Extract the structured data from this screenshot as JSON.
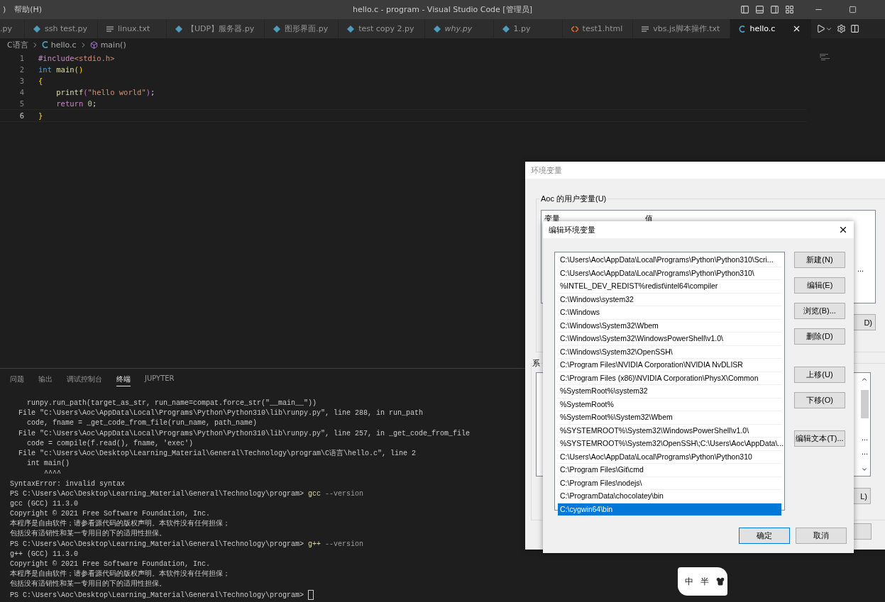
{
  "window": {
    "menu": [
      {
        "label": ")"
      },
      {
        "label": "帮助(H)"
      }
    ],
    "title": "hello.c - program - Visual Studio Code [管理员]"
  },
  "tabs": [
    {
      "label": ".py",
      "selected": false,
      "preview": false
    },
    {
      "label": "ssh test.py",
      "selected": false,
      "preview": false
    },
    {
      "label": "linux.txt",
      "selected": false,
      "preview": false
    },
    {
      "label": "【UDP】服务器.py",
      "selected": false,
      "preview": false
    },
    {
      "label": "图形界面.py",
      "selected": false,
      "preview": false
    },
    {
      "label": "test copy 2.py",
      "selected": false,
      "preview": false
    },
    {
      "label": "why.py",
      "selected": false,
      "preview": true
    },
    {
      "label": "1.py",
      "selected": false,
      "preview": false
    },
    {
      "label": "test1.html",
      "selected": false,
      "preview": false
    },
    {
      "label": "vbs.js脚本操作.txt",
      "selected": false,
      "preview": false
    },
    {
      "label": "hello.c",
      "selected": true,
      "preview": false
    }
  ],
  "breadcrumb": [
    {
      "label": "C语言"
    },
    {
      "label": "hello.c"
    },
    {
      "label": "main()"
    }
  ],
  "editor": {
    "lines": [
      {
        "number": "1",
        "active": false,
        "tokens": [
          {
            "text": "#include",
            "kind": "control"
          },
          {
            "text": "<stdio.h>",
            "kind": "string"
          }
        ]
      },
      {
        "number": "2",
        "active": false,
        "tokens": [
          {
            "text": "int",
            "kind": "type"
          },
          {
            "text": " main",
            "kind": "function"
          },
          {
            "text": "()",
            "kind": "bracket"
          }
        ]
      },
      {
        "number": "3",
        "active": false,
        "tokens": [
          {
            "text": "{",
            "kind": "bracket"
          }
        ]
      },
      {
        "number": "4",
        "active": false,
        "tokens": [
          {
            "text": "    printf",
            "kind": "function"
          },
          {
            "text": "(",
            "kind": "bracket2"
          },
          {
            "text": "\"hello world\"",
            "kind": "string"
          },
          {
            "text": ")",
            "kind": "bracket2"
          },
          {
            "text": ";",
            "kind": "plain"
          }
        ]
      },
      {
        "number": "5",
        "active": false,
        "tokens": [
          {
            "text": "    return",
            "kind": "control"
          },
          {
            "text": " 0",
            "kind": "number"
          },
          {
            "text": ";",
            "kind": "plain"
          }
        ]
      },
      {
        "number": "6",
        "active": true,
        "tokens": [
          {
            "text": "}",
            "kind": "bracket"
          }
        ]
      }
    ]
  },
  "panel": {
    "tabs": [
      {
        "label": "问题",
        "selected": false
      },
      {
        "label": "输出",
        "selected": false
      },
      {
        "label": "调试控制台",
        "selected": false
      },
      {
        "label": "终端",
        "selected": true
      },
      {
        "label": "JUPYTER",
        "selected": false
      }
    ],
    "terminal": [
      {
        "kind": "output",
        "text": "    runpy.run_path(target_as_str, run_name=compat.force_str(\"__main__\"))"
      },
      {
        "kind": "output",
        "text": "  File \"C:\\Users\\Aoc\\AppData\\Local\\Programs\\Python\\Python310\\lib\\runpy.py\", line 288, in run_path"
      },
      {
        "kind": "output",
        "text": "    code, fname = _get_code_from_file(run_name, path_name)"
      },
      {
        "kind": "output",
        "text": "  File \"C:\\Users\\Aoc\\AppData\\Local\\Programs\\Python\\Python310\\lib\\runpy.py\", line 257, in _get_code_from_file"
      },
      {
        "kind": "output",
        "text": "    code = compile(f.read(), fname, 'exec')"
      },
      {
        "kind": "output",
        "text": "  File \"c:\\Users\\Aoc\\Desktop\\Learning_Material\\General\\Technology\\program\\C语言\\hello.c\", line 2"
      },
      {
        "kind": "output",
        "text": "    int main()"
      },
      {
        "kind": "output",
        "text": "        ^^^^"
      },
      {
        "kind": "output",
        "text": "SyntaxError: invalid syntax"
      },
      {
        "kind": "prompt",
        "text": "PS C:\\Users\\Aoc\\Desktop\\Learning_Material\\General\\Technology\\program> ",
        "command": "gcc",
        "args": " --version"
      },
      {
        "kind": "output",
        "text": "gcc (GCC) 11.3.0"
      },
      {
        "kind": "output",
        "text": "Copyright © 2021 Free Software Foundation, Inc."
      },
      {
        "kind": "output",
        "text": "本程序是自由软件；请参看源代码的版权声明。本软件没有任何担保；"
      },
      {
        "kind": "output",
        "text": "包括没有适销性和某一专用目的下的适用性担保。"
      },
      {
        "kind": "prompt",
        "text": "PS C:\\Users\\Aoc\\Desktop\\Learning_Material\\General\\Technology\\program> ",
        "command": "g++",
        "args": " --version"
      },
      {
        "kind": "output",
        "text": "g++ (GCC) 11.3.0"
      },
      {
        "kind": "output",
        "text": "Copyright © 2021 Free Software Foundation, Inc."
      },
      {
        "kind": "output",
        "text": "本程序是自由软件；请参看源代码的版权声明。本软件没有任何担保；"
      },
      {
        "kind": "output",
        "text": "包括没有适销性和某一专用目的下的适用性担保。"
      },
      {
        "kind": "cursor",
        "text": "PS C:\\Users\\Aoc\\Desktop\\Learning_Material\\General\\Technology\\program> "
      }
    ]
  },
  "env_dialog": {
    "title": "环境变量",
    "user_group": "Aoc 的用户变量(U)",
    "columns": [
      "变量",
      "值"
    ],
    "user_row_tail": "...",
    "user_button": "D)",
    "system_group": "系",
    "system_row_tails": [
      "...",
      "..."
    ],
    "system_button": "L)"
  },
  "edit_dialog": {
    "title": "编辑环境变量",
    "items": [
      {
        "text": "C:\\Users\\Aoc\\AppData\\Local\\Programs\\Python\\Python310\\Scri...",
        "selected": false
      },
      {
        "text": "C:\\Users\\Aoc\\AppData\\Local\\Programs\\Python\\Python310\\",
        "selected": false
      },
      {
        "text": "%INTEL_DEV_REDIST%redist\\intel64\\compiler",
        "selected": false
      },
      {
        "text": "C:\\Windows\\system32",
        "selected": false
      },
      {
        "text": "C:\\Windows",
        "selected": false
      },
      {
        "text": "C:\\Windows\\System32\\Wbem",
        "selected": false
      },
      {
        "text": "C:\\Windows\\System32\\WindowsPowerShell\\v1.0\\",
        "selected": false
      },
      {
        "text": "C:\\Windows\\System32\\OpenSSH\\",
        "selected": false
      },
      {
        "text": "C:\\Program Files\\NVIDIA Corporation\\NVIDIA NvDLISR",
        "selected": false
      },
      {
        "text": "C:\\Program Files (x86)\\NVIDIA Corporation\\PhysX\\Common",
        "selected": false
      },
      {
        "text": "%SystemRoot%\\system32",
        "selected": false
      },
      {
        "text": "%SystemRoot%",
        "selected": false
      },
      {
        "text": "%SystemRoot%\\System32\\Wbem",
        "selected": false
      },
      {
        "text": "%SYSTEMROOT%\\System32\\WindowsPowerShell\\v1.0\\",
        "selected": false
      },
      {
        "text": "%SYSTEMROOT%\\System32\\OpenSSH\\;C:\\Users\\Aoc\\AppData\\...",
        "selected": false
      },
      {
        "text": "C:\\Users\\Aoc\\AppData\\Local\\Programs\\Python\\Python310",
        "selected": false
      },
      {
        "text": "C:\\Program Files\\Git\\cmd",
        "selected": false
      },
      {
        "text": "C:\\Program Files\\nodejs\\",
        "selected": false
      },
      {
        "text": "C:\\ProgramData\\chocolatey\\bin",
        "selected": false
      },
      {
        "text": "C:\\cygwin64\\bin",
        "selected": true
      }
    ],
    "button_groups": [
      {
        "buttons": [
          "新建(N)",
          "编辑(E)",
          "浏览(B)...",
          "删除(D)"
        ]
      },
      {
        "buttons": [
          "上移(U)",
          "下移(O)"
        ]
      },
      {
        "buttons": [
          "编辑文本(T)..."
        ]
      }
    ],
    "ok": "确定",
    "cancel": "取消"
  },
  "ime": {
    "mode": "中",
    "width": "半"
  }
}
